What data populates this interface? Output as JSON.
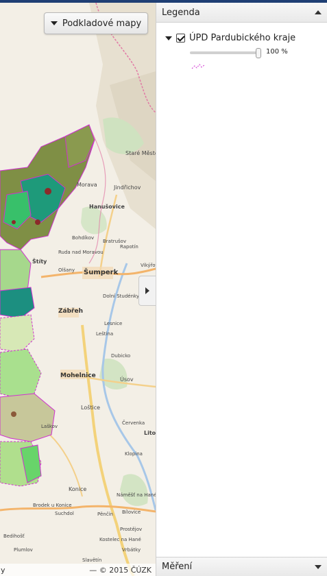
{
  "map": {
    "basemap_button": {
      "label": "Podkladové mapy",
      "icon": "caret-down-icon"
    },
    "toggle_panel_icon": "triangle-right-icon",
    "attribution": {
      "left": "y",
      "right": "— © 2015 ČÚZK"
    },
    "place_labels": [
      "Staré Město",
      "Morava",
      "Jindřichov",
      "Hanušovice",
      "Bohdíkov",
      "Bratrušov",
      "Šumperk",
      "Zábřeh",
      "Mohelnice",
      "Úsov",
      "Loštice",
      "Červenka",
      "Litovel",
      "Konice",
      "Brodek u Konice",
      "Suchdol",
      "Kostelec na Hané",
      "Plumlov",
      "Prostějov",
      "Ruda nad Moravou",
      "Olšany",
      "Štíty",
      "Rapotín",
      "Vikýřovice",
      "Dolní Studénky",
      "Lesnice",
      "Leština",
      "Dubicko",
      "Klopina",
      "Laškov",
      "Pěnčín",
      "Bílovice",
      "Vrbátky",
      "Bedihošť",
      "Slavětín",
      "Náměšť na Hané"
    ]
  },
  "legend": {
    "title": "Legenda",
    "collapse_icon": "triangle-up-icon",
    "layer": {
      "name": "ÚPD Pardubického kraje",
      "checked": true,
      "opacity_value": "100 %",
      "opacity": 1.0
    }
  },
  "measure": {
    "title": "Měření",
    "expand_icon": "triangle-down-icon"
  }
}
